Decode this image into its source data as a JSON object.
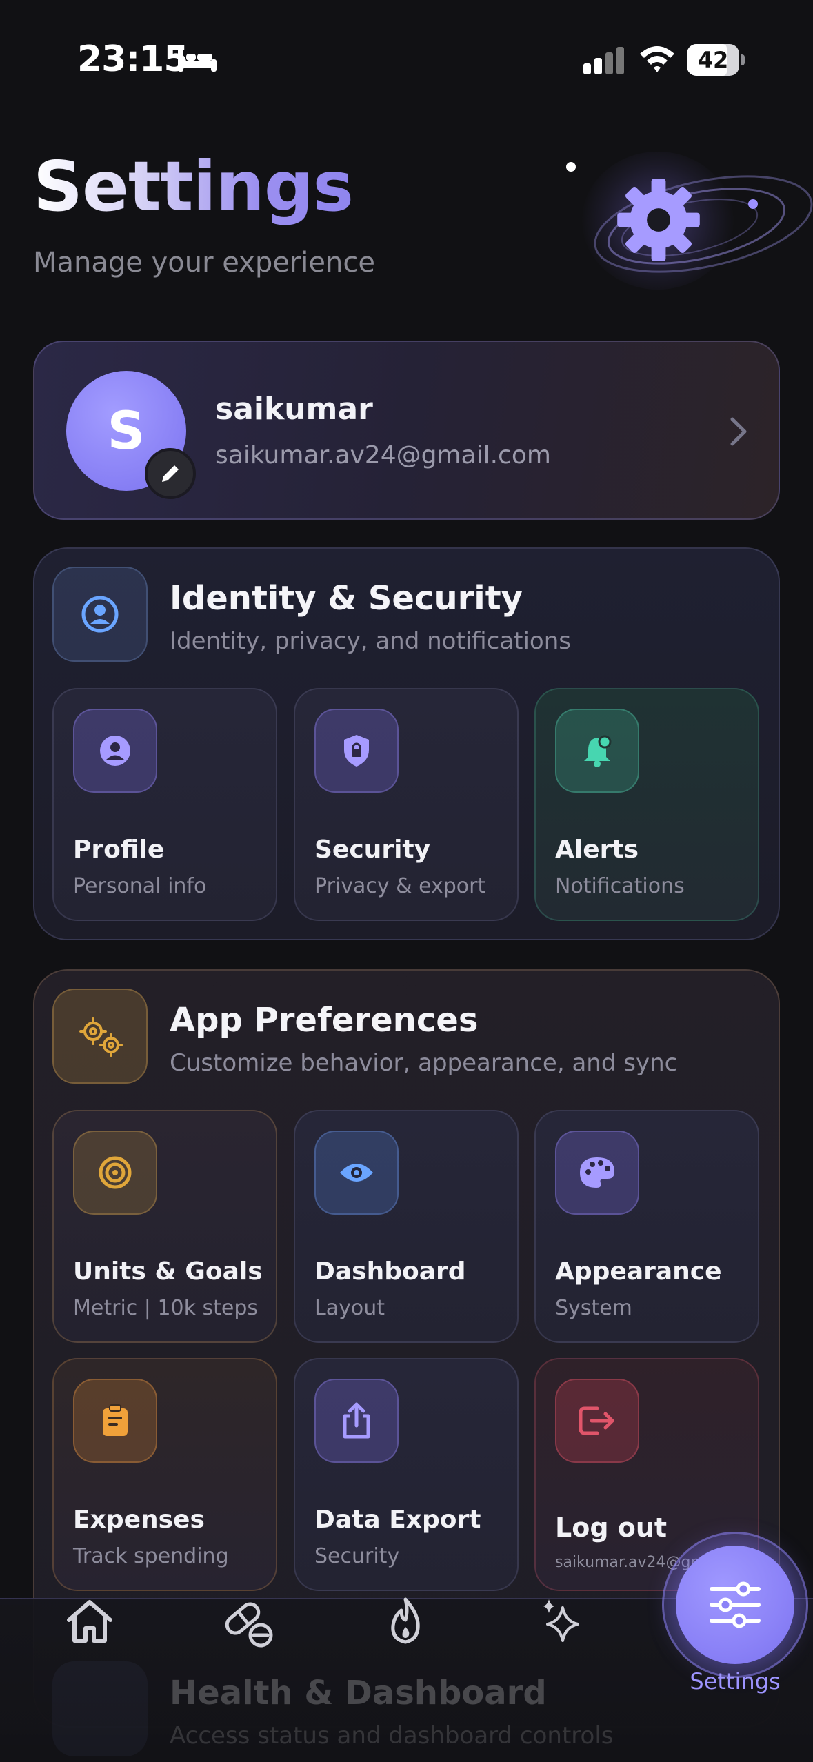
{
  "status_bar": {
    "time": "23:15",
    "battery": "42"
  },
  "header": {
    "title": "Settings",
    "subtitle": "Manage your experience"
  },
  "profile": {
    "initial": "S",
    "name": "saikumar",
    "email": "saikumar.av24@gmail.com"
  },
  "identity_section": {
    "title": "Identity & Security",
    "subtitle": "Identity, privacy, and notifications",
    "tiles": [
      {
        "title": "Profile",
        "subtitle": "Personal info"
      },
      {
        "title": "Security",
        "subtitle": "Privacy & export"
      },
      {
        "title": "Alerts",
        "subtitle": "Notifications"
      }
    ]
  },
  "prefs_section": {
    "title": "App Preferences",
    "subtitle": "Customize behavior, appearance, and sync",
    "tiles": [
      {
        "title": "Units & Goals",
        "subtitle": "Metric | 10k steps"
      },
      {
        "title": "Dashboard",
        "subtitle": "Layout"
      },
      {
        "title": "Appearance",
        "subtitle": "System"
      },
      {
        "title": "Expenses",
        "subtitle": "Track spending"
      },
      {
        "title": "Data Export",
        "subtitle": "Security"
      },
      {
        "title": "Log out",
        "subtitle": "saikumar.av24@gmail.co"
      }
    ]
  },
  "next_section": {
    "title": "Health & Dashboard",
    "subtitle": "Access status and dashboard controls"
  },
  "nav": {
    "settings_label": "Settings",
    "items": [
      "home-icon",
      "pill-icon",
      "flame-icon",
      "sparkle-icon",
      "sliders-icon"
    ]
  },
  "colors": {
    "accent": "#8b82f7",
    "teal": "#47d6b0",
    "gold": "#e0a63a",
    "orange": "#f0a13a",
    "red": "#e0556a",
    "blue": "#6aa5ff"
  }
}
